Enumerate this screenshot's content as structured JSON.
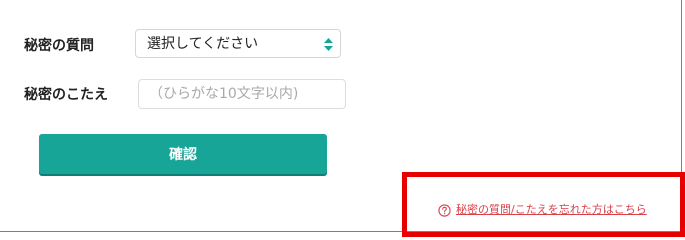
{
  "form": {
    "secret_question_label": "秘密の質問",
    "secret_question_select": {
      "selected": "選択してください"
    },
    "secret_answer_label": "秘密のこたえ",
    "secret_answer_input": {
      "value": "",
      "placeholder": "（ひらがな10文字以内)"
    },
    "confirm_button_label": "確認"
  },
  "help_link": {
    "icon": "question-circle-icon",
    "text": "秘密の質問/こたえを忘れた方はこちら"
  },
  "colors": {
    "accent": "#17a598",
    "link": "#d9404a",
    "highlight": "#e60000"
  }
}
